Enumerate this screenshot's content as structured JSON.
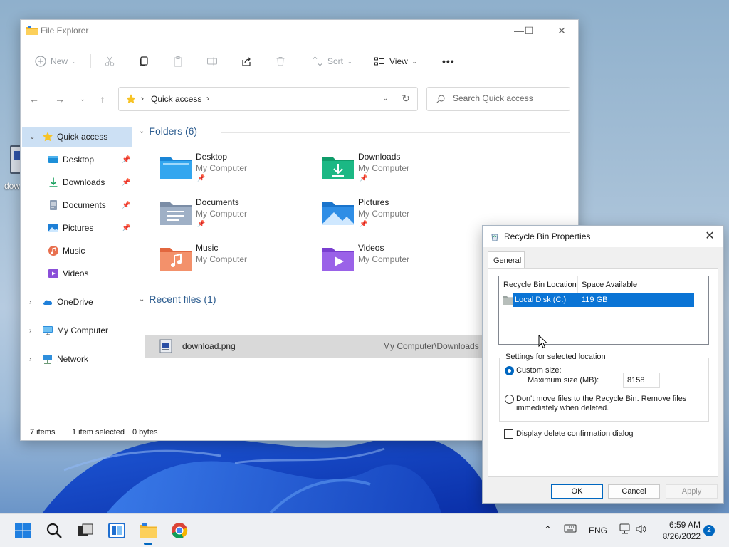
{
  "desktop": {
    "icon_label": "dow"
  },
  "explorer": {
    "title": "File Explorer",
    "toolbar": {
      "new_label": "New",
      "sort_label": "Sort",
      "view_label": "View",
      "more_label": "•••"
    },
    "address": {
      "crumb": "Quick access"
    },
    "search": {
      "placeholder": "Search Quick access"
    },
    "sidebar": {
      "items": [
        {
          "label": "Quick access",
          "icon": "star-icon"
        },
        {
          "label": "Desktop",
          "icon": "desktop-folder-icon"
        },
        {
          "label": "Downloads",
          "icon": "download-icon"
        },
        {
          "label": "Documents",
          "icon": "document-icon"
        },
        {
          "label": "Pictures",
          "icon": "picture-icon"
        },
        {
          "label": "Music",
          "icon": "music-icon"
        },
        {
          "label": "Videos",
          "icon": "video-icon"
        },
        {
          "label": "OneDrive",
          "icon": "cloud-icon"
        },
        {
          "label": "My Computer",
          "icon": "computer-icon"
        },
        {
          "label": "Network",
          "icon": "network-icon"
        }
      ]
    },
    "folders_header": "Folders (6)",
    "folders": [
      {
        "name": "Desktop",
        "location": "My Computer"
      },
      {
        "name": "Downloads",
        "location": "My Computer"
      },
      {
        "name": "Documents",
        "location": "My Computer"
      },
      {
        "name": "Pictures",
        "location": "My Computer"
      },
      {
        "name": "Music",
        "location": "My Computer"
      },
      {
        "name": "Videos",
        "location": "My Computer"
      }
    ],
    "recent_header": "Recent files (1)",
    "recent_files": [
      {
        "name": "download.png",
        "path": "My Computer\\Downloads"
      }
    ],
    "status": {
      "items": "7 items",
      "selected": "1 item selected",
      "size": "0 bytes"
    }
  },
  "dialog": {
    "title": "Recycle Bin Properties",
    "tab": "General",
    "list": {
      "col_location": "Recycle Bin Location",
      "col_space": "Space Available",
      "row_location": "Local Disk (C:)",
      "row_space": "119 GB"
    },
    "settings_legend": "Settings for selected location",
    "custom_size_label": "Custom size:",
    "max_size_label": "Maximum size (MB):",
    "max_size_value": "8158",
    "dont_move_label_1": "Don't move files to the Recycle Bin. Remove files",
    "dont_move_label_2": "immediately when deleted.",
    "confirm_label": "Display delete confirmation dialog",
    "ok_label": "OK",
    "cancel_label": "Cancel",
    "apply_label": "Apply"
  },
  "taskbar": {
    "language": "ENG",
    "time": "6:59 AM",
    "date": "8/26/2022",
    "notifications": "2"
  },
  "colors": {
    "accent": "#0067c0",
    "selection": "#0a74d5",
    "folder_header": "#2c5c8f"
  }
}
